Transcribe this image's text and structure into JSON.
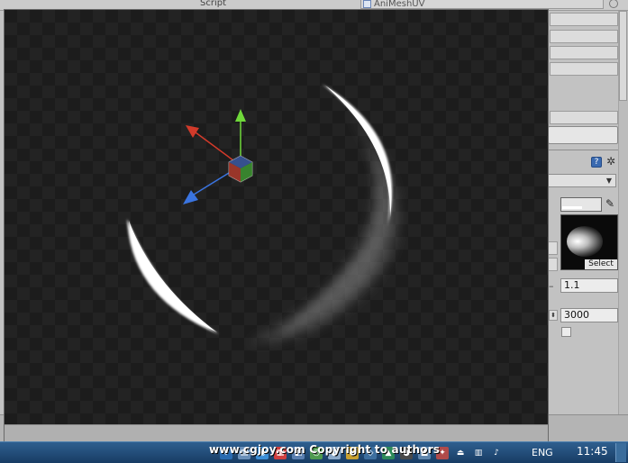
{
  "inspector": {
    "script_label": "Script",
    "script_value": "AniMeshUV",
    "texture_select_label": "Select",
    "float_value": "1.1",
    "int_value": "3000",
    "dash_label": "–"
  },
  "scene": {
    "gizmo_colors": {
      "x_axis": "#d23a2a",
      "y_axis": "#6fd83a",
      "z_axis": "#3a74e0"
    }
  },
  "watermark": "www.cgjoy.com Copyright to authors",
  "taskbar": {
    "icons": [
      "shield-icon",
      "folder-icon",
      "chrome-icon",
      "app-icon-1",
      "app-icon-2",
      "app-icon-3",
      "app-icon-4",
      "app-icon-5",
      "app-icon-6",
      "app-icon-7",
      "app-icon-8",
      "app-icon-9",
      "app-icon-10",
      "usb-icon",
      "network-icon",
      "volume-icon"
    ],
    "language": "ENG",
    "time": "11:45"
  }
}
